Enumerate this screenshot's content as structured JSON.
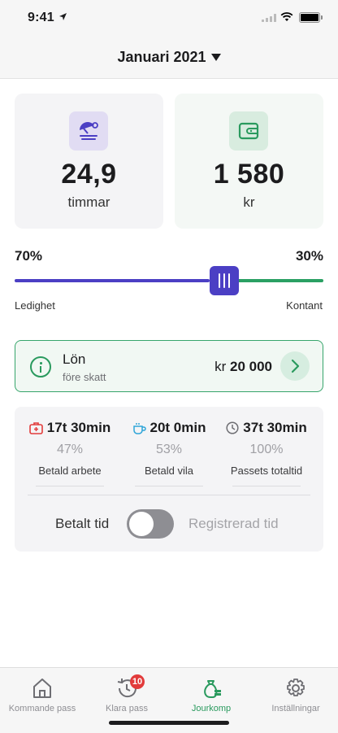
{
  "status": {
    "time": "9:41"
  },
  "header": {
    "month": "Januari 2021"
  },
  "cards": [
    {
      "value": "24,9",
      "unit": "timmar",
      "icon": "beach-umbrella-icon"
    },
    {
      "value": "1 580",
      "unit": "kr",
      "icon": "wallet-icon"
    }
  ],
  "split": {
    "left_pct": "70%",
    "right_pct": "30%",
    "left_label": "Ledighet",
    "right_label": "Kontant",
    "value_fraction": 0.7,
    "colors": {
      "left": "#4b3fc4",
      "right": "#2aa063"
    }
  },
  "salary": {
    "title": "Lön",
    "subtitle": "före skatt",
    "currency": "kr",
    "amount": "20 000"
  },
  "stats": [
    {
      "value": "17t 30min",
      "percent": "47%",
      "label": "Betald arbete",
      "icon": "first-aid-icon",
      "color": "#e23b3b"
    },
    {
      "value": "20t 0min",
      "percent": "53%",
      "label": "Betald vila",
      "icon": "coffee-icon",
      "color": "#2fa5d8"
    },
    {
      "value": "37t 30min",
      "percent": "100%",
      "label": "Passets totaltid",
      "icon": "clock-icon",
      "color": "#6e6e73"
    }
  ],
  "toggle": {
    "left": "Betalt tid",
    "right": "Registrerad tid"
  },
  "tabs": [
    {
      "label": "Kommande pass",
      "icon": "home-icon"
    },
    {
      "label": "Klara pass",
      "icon": "history-icon",
      "badge": "10"
    },
    {
      "label": "Jourkomp",
      "icon": "money-bag-icon",
      "active": true
    },
    {
      "label": "Inställningar",
      "icon": "gear-icon"
    }
  ]
}
